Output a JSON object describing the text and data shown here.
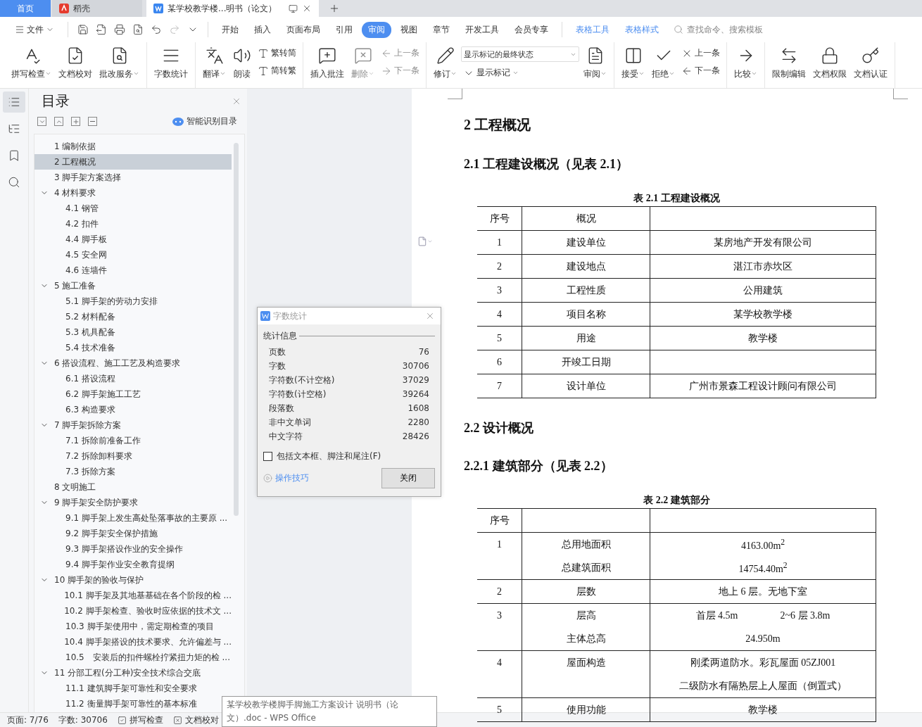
{
  "title_tabs": [
    {
      "label": "首页",
      "kind": "home",
      "selected": false
    },
    {
      "label": "稻壳",
      "kind": "app",
      "selected": false
    },
    {
      "label": "某学校教学楼...明书（论文）",
      "kind": "document",
      "selected": true
    }
  ],
  "menu": {
    "file": "文件",
    "tabs": [
      {
        "label": "开始",
        "selected": false
      },
      {
        "label": "插入",
        "selected": false
      },
      {
        "label": "页面布局",
        "selected": false
      },
      {
        "label": "引用",
        "selected": false
      },
      {
        "label": "审阅",
        "selected": true
      },
      {
        "label": "视图",
        "selected": false
      },
      {
        "label": "章节",
        "selected": false
      },
      {
        "label": "开发工具",
        "selected": false
      },
      {
        "label": "会员专享",
        "selected": false
      }
    ],
    "context_tabs": [
      "表格工具",
      "表格样式"
    ],
    "search": {
      "placeholder": "查找命令、搜索模板"
    }
  },
  "ribbon": [
    [
      {
        "kind": "large",
        "label": "拼写检查",
        "caret": true,
        "disabled": false
      },
      {
        "kind": "large",
        "label": "文档校对",
        "caret": false,
        "disabled": false
      },
      {
        "kind": "large",
        "label": "批改服务",
        "caret": true,
        "disabled": false
      }
    ],
    [
      {
        "kind": "large",
        "label": "字数统计",
        "caret": false,
        "disabled": false
      }
    ],
    [
      {
        "kind": "large",
        "label": "翻译",
        "caret": true,
        "disabled": false
      },
      {
        "kind": "large",
        "label": "朗读",
        "caret": false,
        "disabled": false
      },
      {
        "kind": "stack",
        "items": [
          {
            "kind": "small",
            "label": "繁转简",
            "caret": false,
            "disabled": false
          },
          {
            "kind": "small",
            "label": "简转繁",
            "caret": false,
            "disabled": false
          }
        ]
      }
    ],
    [
      {
        "kind": "large",
        "label": "插入批注",
        "caret": false,
        "disabled": false
      },
      {
        "kind": "large",
        "label": "删除",
        "caret": true,
        "disabled": true
      },
      {
        "kind": "stack",
        "items": [
          {
            "kind": "small",
            "label": "上一条",
            "caret": false,
            "disabled": true
          },
          {
            "kind": "small",
            "label": "下一条",
            "caret": false,
            "disabled": true
          }
        ]
      }
    ],
    [
      {
        "kind": "large",
        "label": "修订",
        "caret": true,
        "disabled": false
      },
      {
        "kind": "stack",
        "items": [
          {
            "kind": "select",
            "label": "显示标记的最终状态",
            "caret": true
          },
          {
            "kind": "small",
            "label": "显示标记",
            "caret": true,
            "disabled": false
          }
        ]
      },
      {
        "kind": "large",
        "label": "审阅",
        "caret": true,
        "disabled": false
      }
    ],
    [
      {
        "kind": "large",
        "label": "接受",
        "caret": true,
        "disabled": false
      },
      {
        "kind": "large",
        "label": "拒绝",
        "caret": true,
        "disabled": false
      },
      {
        "kind": "stack",
        "items": [
          {
            "kind": "small",
            "label": "上一条",
            "caret": false,
            "disabled": false
          },
          {
            "kind": "small",
            "label": "下一条",
            "caret": false,
            "disabled": false
          }
        ]
      }
    ],
    [
      {
        "kind": "large",
        "label": "比较",
        "caret": true,
        "disabled": false
      }
    ],
    [
      {
        "kind": "large",
        "label": "限制编辑",
        "caret": false,
        "disabled": false
      },
      {
        "kind": "large",
        "label": "文档权限",
        "caret": false,
        "disabled": false
      },
      {
        "kind": "large",
        "label": "文档认证",
        "caret": false,
        "disabled": false
      }
    ]
  ],
  "toc": {
    "title": "目录",
    "smart_button": "智能识别目录",
    "items": [
      {
        "label": "1 编制依据",
        "selected": false
      },
      {
        "label": "2 工程概况",
        "selected": true
      },
      {
        "label": "3 脚手架方案选择",
        "selected": false
      },
      {
        "label": "4 材料要求",
        "selected": false,
        "expanded": true,
        "children": [
          {
            "label": "4.1 钢管",
            "selected": false
          },
          {
            "label": "4.2 扣件",
            "selected": false
          },
          {
            "label": "4.4 脚手板",
            "selected": false
          },
          {
            "label": "4.5 安全网",
            "selected": false
          },
          {
            "label": "4.6 连墙件",
            "selected": false
          }
        ]
      },
      {
        "label": "5 施工准备",
        "selected": false,
        "expanded": true,
        "children": [
          {
            "label": "5.1 脚手架的劳动力安排",
            "selected": false
          },
          {
            "label": "5.2 材料配备",
            "selected": false
          },
          {
            "label": "5.3 机具配备",
            "selected": false
          },
          {
            "label": "5.4 技术准备",
            "selected": false
          }
        ]
      },
      {
        "label": "6 搭设流程、施工工艺及构造要求",
        "selected": false,
        "expanded": true,
        "children": [
          {
            "label": "6.1 搭设流程",
            "selected": false
          },
          {
            "label": "6.2 脚手架施工工艺",
            "selected": false
          },
          {
            "label": "6.3 构造要求",
            "selected": false
          }
        ]
      },
      {
        "label": "7 脚手架拆除方案",
        "selected": false,
        "expanded": true,
        "children": [
          {
            "label": "7.1 拆除前准备工作",
            "selected": false
          },
          {
            "label": "7.2 拆除卸料要求",
            "selected": false
          },
          {
            "label": "7.3 拆除方案",
            "selected": false
          }
        ]
      },
      {
        "label": "8 文明施工",
        "selected": false
      },
      {
        "label": "9 脚手架安全防护要求",
        "selected": false,
        "expanded": true,
        "children": [
          {
            "label": "9.1 脚手架上发生高处坠落事故的主要原 ...",
            "selected": false
          },
          {
            "label": "9.2 脚手架安全保护措施",
            "selected": false
          },
          {
            "label": "9.3 脚手架搭设作业的安全操作",
            "selected": false
          },
          {
            "label": "9.4 脚手架作业安全教育提纲",
            "selected": false
          }
        ]
      },
      {
        "label": "10 脚手架的验收与保护",
        "selected": false,
        "expanded": true,
        "children": [
          {
            "label": "10.1 脚手架及其地基基础在各个阶段的检 ...",
            "selected": false
          },
          {
            "label": "10.2 脚手架检查、验收时应依据的技术文 ...",
            "selected": false
          },
          {
            "label": "10.3 脚手架使用中，需定期检查的项目",
            "selected": false
          },
          {
            "label": "10.4 脚手架搭设的技术要求、允许偏差与 ...",
            "selected": false
          },
          {
            "label": "10.5　安装后的扣件螺栓拧紧扭力矩的检 ...",
            "selected": false
          }
        ]
      },
      {
        "label": "11 分部工程(分工种)安全技术综合交底",
        "selected": false,
        "expanded": true,
        "children": [
          {
            "label": "11.1 建筑脚手架可靠性和安全要求",
            "selected": false
          },
          {
            "label": "11.2 衡量脚手架可靠性的基本标准",
            "selected": false
          }
        ]
      }
    ]
  },
  "dialog": {
    "title": "字数统计",
    "group": "统计信息",
    "rows": [
      {
        "label": "页数",
        "value": "76"
      },
      {
        "label": "字数",
        "value": "30706"
      },
      {
        "label": "字符数(不计空格)",
        "value": "37029"
      },
      {
        "label": "字符数(计空格)",
        "value": "39264"
      },
      {
        "label": "段落数",
        "value": "1608"
      },
      {
        "label": "非中文单词",
        "value": "2280"
      },
      {
        "label": "中文字符",
        "value": "28426"
      }
    ],
    "checkbox": {
      "label": "包括文本框、脚注和尾注(F)",
      "checked": false
    },
    "link": "操作技巧",
    "button": "关闭"
  },
  "document": [
    {
      "kind": "h1",
      "text": "2 工程概况"
    },
    {
      "kind": "h2",
      "text": "2.1 工程建设概况（见表 2.1）"
    },
    {
      "kind": "table",
      "caption": "表 2.1  工程建设概况",
      "header": [
        "序号",
        "概况"
      ],
      "rows": [
        {
          "cells": [
            "1",
            "建设单位",
            "某房地产开发有限公司"
          ]
        },
        {
          "cells": [
            "2",
            "建设地点",
            "湛江市赤坎区"
          ]
        },
        {
          "cells": [
            "3",
            "工程性质",
            "公用建筑"
          ]
        },
        {
          "cells": [
            "4",
            "项目名称",
            "某学校教学楼"
          ]
        },
        {
          "cells": [
            "5",
            "用途",
            "教学楼"
          ]
        },
        {
          "cells": [
            "6",
            "开竣工日期"
          ]
        },
        {
          "cells": [
            "7",
            "设计单位",
            "广州市景森工程设计顾问有限公司"
          ]
        }
      ]
    },
    {
      "kind": "h2",
      "text": "2.2  设计概况"
    },
    {
      "kind": "h2",
      "text": "2.2.1 建筑部分（见表 2.2）"
    },
    {
      "kind": "table",
      "caption": "表 2.2  建筑部分",
      "header": [
        "序号"
      ],
      "rows": [
        {
          "cells": [
            "1",
            [
              "总用地面积",
              "总建筑面积"
            ],
            [
              "4163.00m$^{2}$",
              "14754.40m$^{2}$"
            ]
          ]
        },
        {
          "cells": [
            "2",
            "层数",
            "地上 6 层。无地下室"
          ]
        },
        {
          "cells": [
            "3",
            [
              "层高",
              "主体总高"
            ],
            [
              [
                "首层 4.5m",
                "2~6 层 3.8m"
              ],
              "24.950m"
            ]
          ]
        },
        {
          "cells": [
            "4",
            "屋面构造",
            [
              "刚柔两道防水。彩瓦屋面 05ZJ001",
              "二级防水有隔热层上人屋面（倒置式）"
            ]
          ]
        },
        {
          "cells": [
            "5",
            "使用功能",
            "教学楼"
          ]
        }
      ]
    }
  ],
  "status_bar": {
    "page": "页面: 7/76",
    "words": "字数: 30706",
    "items": [
      "拼写检查",
      "文档校对"
    ]
  },
  "tooltip": "某学校教学楼脚手脚施工方案设计 说明书（论文）.doc - WPS Office"
}
